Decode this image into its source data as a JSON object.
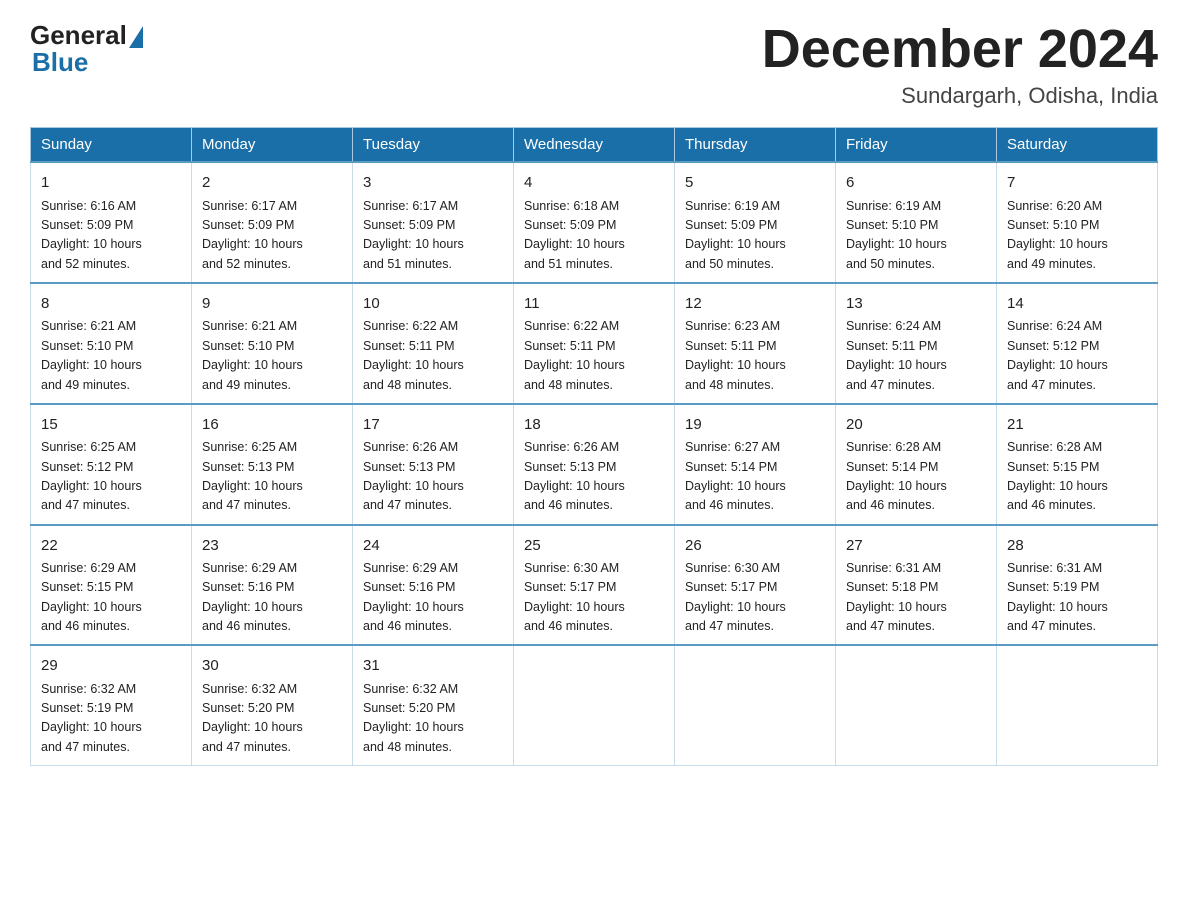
{
  "header": {
    "logo_general": "General",
    "logo_blue": "Blue",
    "month_title": "December 2024",
    "subtitle": "Sundargarh, Odisha, India"
  },
  "days_of_week": [
    "Sunday",
    "Monday",
    "Tuesday",
    "Wednesday",
    "Thursday",
    "Friday",
    "Saturday"
  ],
  "weeks": [
    [
      {
        "day": "1",
        "sunrise": "6:16 AM",
        "sunset": "5:09 PM",
        "daylight": "10 hours and 52 minutes."
      },
      {
        "day": "2",
        "sunrise": "6:17 AM",
        "sunset": "5:09 PM",
        "daylight": "10 hours and 52 minutes."
      },
      {
        "day": "3",
        "sunrise": "6:17 AM",
        "sunset": "5:09 PM",
        "daylight": "10 hours and 51 minutes."
      },
      {
        "day": "4",
        "sunrise": "6:18 AM",
        "sunset": "5:09 PM",
        "daylight": "10 hours and 51 minutes."
      },
      {
        "day": "5",
        "sunrise": "6:19 AM",
        "sunset": "5:09 PM",
        "daylight": "10 hours and 50 minutes."
      },
      {
        "day": "6",
        "sunrise": "6:19 AM",
        "sunset": "5:10 PM",
        "daylight": "10 hours and 50 minutes."
      },
      {
        "day": "7",
        "sunrise": "6:20 AM",
        "sunset": "5:10 PM",
        "daylight": "10 hours and 49 minutes."
      }
    ],
    [
      {
        "day": "8",
        "sunrise": "6:21 AM",
        "sunset": "5:10 PM",
        "daylight": "10 hours and 49 minutes."
      },
      {
        "day": "9",
        "sunrise": "6:21 AM",
        "sunset": "5:10 PM",
        "daylight": "10 hours and 49 minutes."
      },
      {
        "day": "10",
        "sunrise": "6:22 AM",
        "sunset": "5:11 PM",
        "daylight": "10 hours and 48 minutes."
      },
      {
        "day": "11",
        "sunrise": "6:22 AM",
        "sunset": "5:11 PM",
        "daylight": "10 hours and 48 minutes."
      },
      {
        "day": "12",
        "sunrise": "6:23 AM",
        "sunset": "5:11 PM",
        "daylight": "10 hours and 48 minutes."
      },
      {
        "day": "13",
        "sunrise": "6:24 AM",
        "sunset": "5:11 PM",
        "daylight": "10 hours and 47 minutes."
      },
      {
        "day": "14",
        "sunrise": "6:24 AM",
        "sunset": "5:12 PM",
        "daylight": "10 hours and 47 minutes."
      }
    ],
    [
      {
        "day": "15",
        "sunrise": "6:25 AM",
        "sunset": "5:12 PM",
        "daylight": "10 hours and 47 minutes."
      },
      {
        "day": "16",
        "sunrise": "6:25 AM",
        "sunset": "5:13 PM",
        "daylight": "10 hours and 47 minutes."
      },
      {
        "day": "17",
        "sunrise": "6:26 AM",
        "sunset": "5:13 PM",
        "daylight": "10 hours and 47 minutes."
      },
      {
        "day": "18",
        "sunrise": "6:26 AM",
        "sunset": "5:13 PM",
        "daylight": "10 hours and 46 minutes."
      },
      {
        "day": "19",
        "sunrise": "6:27 AM",
        "sunset": "5:14 PM",
        "daylight": "10 hours and 46 minutes."
      },
      {
        "day": "20",
        "sunrise": "6:28 AM",
        "sunset": "5:14 PM",
        "daylight": "10 hours and 46 minutes."
      },
      {
        "day": "21",
        "sunrise": "6:28 AM",
        "sunset": "5:15 PM",
        "daylight": "10 hours and 46 minutes."
      }
    ],
    [
      {
        "day": "22",
        "sunrise": "6:29 AM",
        "sunset": "5:15 PM",
        "daylight": "10 hours and 46 minutes."
      },
      {
        "day": "23",
        "sunrise": "6:29 AM",
        "sunset": "5:16 PM",
        "daylight": "10 hours and 46 minutes."
      },
      {
        "day": "24",
        "sunrise": "6:29 AM",
        "sunset": "5:16 PM",
        "daylight": "10 hours and 46 minutes."
      },
      {
        "day": "25",
        "sunrise": "6:30 AM",
        "sunset": "5:17 PM",
        "daylight": "10 hours and 46 minutes."
      },
      {
        "day": "26",
        "sunrise": "6:30 AM",
        "sunset": "5:17 PM",
        "daylight": "10 hours and 47 minutes."
      },
      {
        "day": "27",
        "sunrise": "6:31 AM",
        "sunset": "5:18 PM",
        "daylight": "10 hours and 47 minutes."
      },
      {
        "day": "28",
        "sunrise": "6:31 AM",
        "sunset": "5:19 PM",
        "daylight": "10 hours and 47 minutes."
      }
    ],
    [
      {
        "day": "29",
        "sunrise": "6:32 AM",
        "sunset": "5:19 PM",
        "daylight": "10 hours and 47 minutes."
      },
      {
        "day": "30",
        "sunrise": "6:32 AM",
        "sunset": "5:20 PM",
        "daylight": "10 hours and 47 minutes."
      },
      {
        "day": "31",
        "sunrise": "6:32 AM",
        "sunset": "5:20 PM",
        "daylight": "10 hours and 48 minutes."
      },
      null,
      null,
      null,
      null
    ]
  ],
  "labels": {
    "sunrise": "Sunrise:",
    "sunset": "Sunset:",
    "daylight": "Daylight:"
  }
}
